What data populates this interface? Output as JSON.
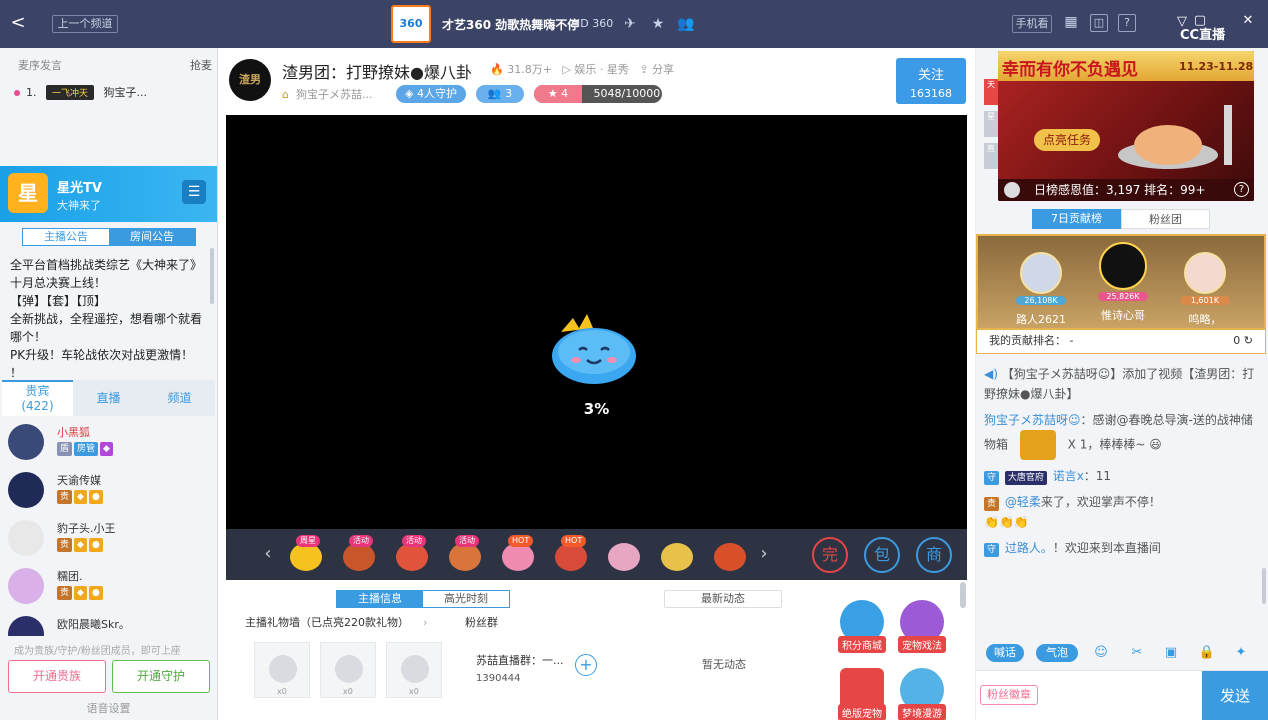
{
  "topbar": {
    "back": "<",
    "prev_channel": "上一个频道",
    "channel_logo": "360",
    "channel_title": "才艺360 劲歌热舞嗨不停",
    "channel_id": "360",
    "phone": "手机看",
    "cc_logo": "CC直播",
    "help": "?"
  },
  "left": {
    "tick_label": "麦序发言",
    "grab": "抢麦",
    "rank_no": "1.",
    "rank_banner": "一飞冲天",
    "rank_user": "狗宝子...",
    "card_logo": "星",
    "card_title": "星光TV",
    "card_sub": "大神来了",
    "ann_tab_anchor": "主播公告",
    "ann_tab_room": "房间公告",
    "announcement": [
      "全平台首档挑战类综艺《大神来了》",
      "十月总决赛上线！",
      "【弹】【套】【顶】",
      "全新挑战，全程遥控，想看哪个就看",
      "哪个！",
      "PK升级！车轮战依次对战更激情！",
      "！"
    ],
    "tab_noble": "贵宾",
    "tab_noble_count": "(422)",
    "tab_live": "直播",
    "tab_channel": "频道",
    "viewers": [
      {
        "name": "小黑狐",
        "badge": "房管"
      },
      {
        "name": "天谕传媒",
        "badge": ""
      },
      {
        "name": "豹子头.小王",
        "badge": ""
      },
      {
        "name": "糯团.",
        "badge": ""
      },
      {
        "name": "欧阳晨曦Skr。",
        "badge": ""
      }
    ],
    "bottom_tip": "成为贵族/守护/粉丝团成员，即可上座",
    "btn_noble": "开通贵族",
    "btn_guard": "开通守护",
    "voice": "语音设置"
  },
  "center": {
    "anchor_avatar": "渣男",
    "room_title": "渣男团：打野撩妹●爆八卦",
    "heat": "31.8万+",
    "category": "娱乐 · 星秀",
    "share": "分享",
    "anchor_name": "狗宝子メ苏喆...",
    "guards": "4人守护",
    "fans": "3",
    "level": "4",
    "exp": "5048/10000",
    "follow": "关注",
    "follow_count": "163168",
    "load_pct": "3%",
    "gifts": [
      {
        "tag": "周星",
        "hot": false,
        "color": "#f6c21d"
      },
      {
        "tag": "活动",
        "hot": false,
        "color": "#c9562a"
      },
      {
        "tag": "活动",
        "hot": false,
        "color": "#e1533b"
      },
      {
        "tag": "活动",
        "hot": false,
        "color": "#d9743a"
      },
      {
        "tag": "HOT",
        "hot": true,
        "color": "#f08cb2"
      },
      {
        "tag": "HOT",
        "hot": true,
        "color": "#d84a3a"
      },
      {
        "tag": "",
        "hot": false,
        "color": "#e7a7c2"
      },
      {
        "tag": "",
        "hot": false,
        "color": "#e7c14a"
      },
      {
        "tag": "",
        "hot": false,
        "color": "#d8502a"
      }
    ],
    "gift_btns": [
      "完",
      "包",
      "商"
    ],
    "tab_info": "主播信息",
    "tab_highlight": "高光时刻",
    "tab_news": "最新动态",
    "gift_wall": "主播礼物墙（已点亮220款礼物）",
    "fans_group": "粉丝群",
    "wall_items": [
      "x0",
      "x0",
      "x0"
    ],
    "group_name": "苏喆直播群：一...",
    "group_num": "1390444",
    "no_news": "暂无动态",
    "apps": [
      {
        "label": "积分商城",
        "color": "#3aa0e6"
      },
      {
        "label": "宠物戏法",
        "color": "#9c5ad6"
      },
      {
        "label": "绝版宠物",
        "color": "#e64646"
      },
      {
        "label": "梦境漫游",
        "color": "#55b2e6"
      }
    ]
  },
  "right": {
    "event_title": "幸而有你不负遇见",
    "event_date": "11.23-11.28",
    "event_task": "点亮任务",
    "event_stat": "日榜感恩值：3,197   排名：99+",
    "side_tags": [
      "天",
      "星",
      "直"
    ],
    "tab_7day": "7日贡献榜",
    "tab_fans": "粉丝团",
    "podium": [
      {
        "name": "路人2621",
        "value": "26,108K"
      },
      {
        "name": "惟诗心哥",
        "value": "25,826K"
      },
      {
        "name": "鸣略，",
        "value": "1,601K"
      }
    ],
    "my_rank": "我的贡献排名：  -",
    "my_rank_val": "0",
    "chat": {
      "sys": "【狗宝子メ苏喆呀☺】添加了视频【渣男团：打野撩妹●爆八卦】",
      "m1_user": "狗宝子メ苏喆呀☺",
      "m1_text": "：感谢@春晚总导演-送的战神储物箱",
      "m1_gift": "X 1，棒棒棒~",
      "m2_user": "诺言x",
      "m2_text": "：11",
      "m2_tag": "大唐官府",
      "m3_user": "@轻柔",
      "m3_text": "来了，欢迎掌声不停！",
      "m4_user": "过路人。",
      "m4_text": "！欢迎来到本直播间"
    },
    "tool_shout": "喊话",
    "tool_bubble": "气泡",
    "fans_badge": "粉丝徽章",
    "send": "发送"
  }
}
